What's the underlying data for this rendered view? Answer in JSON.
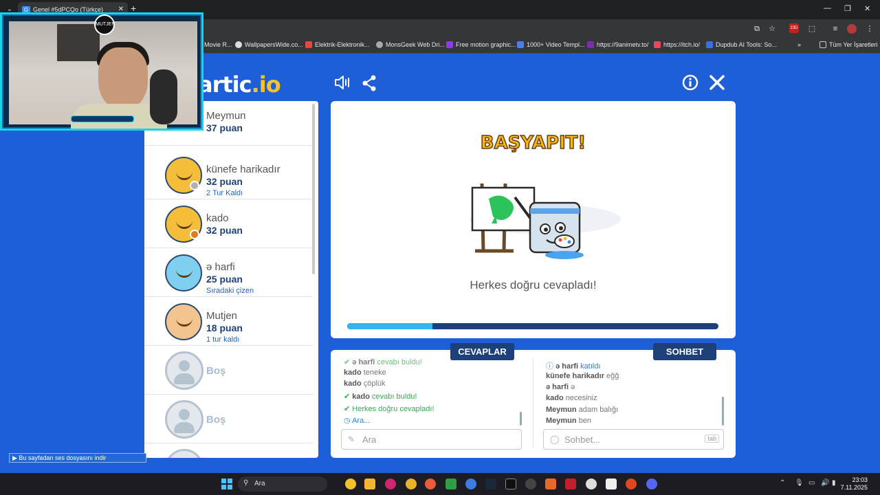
{
  "browser": {
    "tab_title": "Genel #5dPCQo (Türkçe)",
    "bookmarks": [
      "Movie R...",
      "WallpapersWide.co...",
      "Elektrik-Elektronik...",
      "MonsGeek Web Dri...",
      "Free motion graphic...",
      "1000+ Video Templ...",
      "https://9animetv.to/",
      "https://itch.io/",
      "Dupdub AI Tools: So..."
    ],
    "bookmarks_more": "»",
    "all_bookmarks": "Tüm Yer İşaretleri",
    "badge": "23D"
  },
  "webcam": {
    "logo_text": "MUTJEN"
  },
  "game": {
    "logo_main": "artic",
    "logo_tld": ".io",
    "players": [
      {
        "name": "Meymun",
        "score": "37 puan",
        "note": "",
        "dot": "#f5c020"
      },
      {
        "name": "künefe harikadır",
        "score": "32 puan",
        "note": "2 Tur Kaldı",
        "dot": "#b0b0b0"
      },
      {
        "name": "kado",
        "score": "32 puan",
        "note": "",
        "dot": "#e07b1c"
      },
      {
        "name": "ə harfi",
        "score": "25 puan",
        "note": "Sıradaki çizen",
        "dot": ""
      },
      {
        "name": "Mutjen",
        "score": "18 puan",
        "note": "1 tur kaldı",
        "dot": ""
      },
      {
        "name": "Boş"
      },
      {
        "name": "Boş"
      }
    ],
    "result_title": "BAŞYAPIT!",
    "result_message": "Herkes doğru cevapladı!",
    "progress": 0.23,
    "answers_tab": "CEVAPLAR",
    "chat_tab": "SOHBET",
    "answers": [
      {
        "user": "ə harfi",
        "text": "cevabı buldu!",
        "kind": "green"
      },
      {
        "user": "kado",
        "text": "teneke",
        "kind": "normal"
      },
      {
        "user": "kado",
        "text": "çöplük",
        "kind": "normal"
      },
      {
        "user": "kado",
        "text": "cevabı buldu!",
        "kind": "green"
      },
      {
        "user": "",
        "text": "Herkes doğru cevapladı!",
        "kind": "green"
      },
      {
        "user": "",
        "text": "Ara...",
        "kind": "blue"
      }
    ],
    "chat": [
      {
        "user": "ə harfi",
        "text": "katıldı",
        "kind": "blue"
      },
      {
        "user": "künefe harikadır",
        "text": "eğğ",
        "kind": "normal"
      },
      {
        "user": "ə harfi",
        "text": "ə",
        "kind": "normal"
      },
      {
        "user": "kado",
        "text": "necesiniz",
        "kind": "normal"
      },
      {
        "user": "Meymun",
        "text": "adam balığı",
        "kind": "normal"
      },
      {
        "user": "Meymun",
        "text": "ben",
        "kind": "normal"
      }
    ],
    "answer_placeholder": "Ara",
    "chat_placeholder": "Sohbet...",
    "tab_key": "tab"
  },
  "audio_notice": "Bu sayfadan ses dosyasını indir",
  "taskbar": {
    "search": "Ara",
    "time": "23:03",
    "date": "7.11.2025"
  }
}
